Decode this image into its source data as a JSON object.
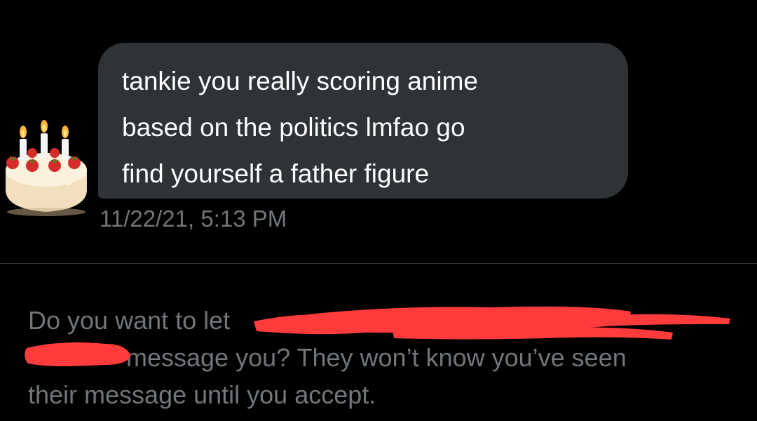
{
  "message": {
    "lines": [
      "tankie you really scoring anime",
      "based on the politics lmfao go",
      "find yourself a father figure"
    ],
    "timestamp": "11/22/21, 5:13 PM"
  },
  "avatar": {
    "icon": "birthday-cake-icon"
  },
  "request_prompt": {
    "line1": "Do you want to let",
    "line2": "message you? They won’t know you’ve seen",
    "line3": "their message until you accept."
  },
  "colors": {
    "background": "#000000",
    "bubble": "#2f3336",
    "message_text": "#ffffff",
    "secondary_text": "#71767b",
    "redaction": "#ff3b3b"
  }
}
